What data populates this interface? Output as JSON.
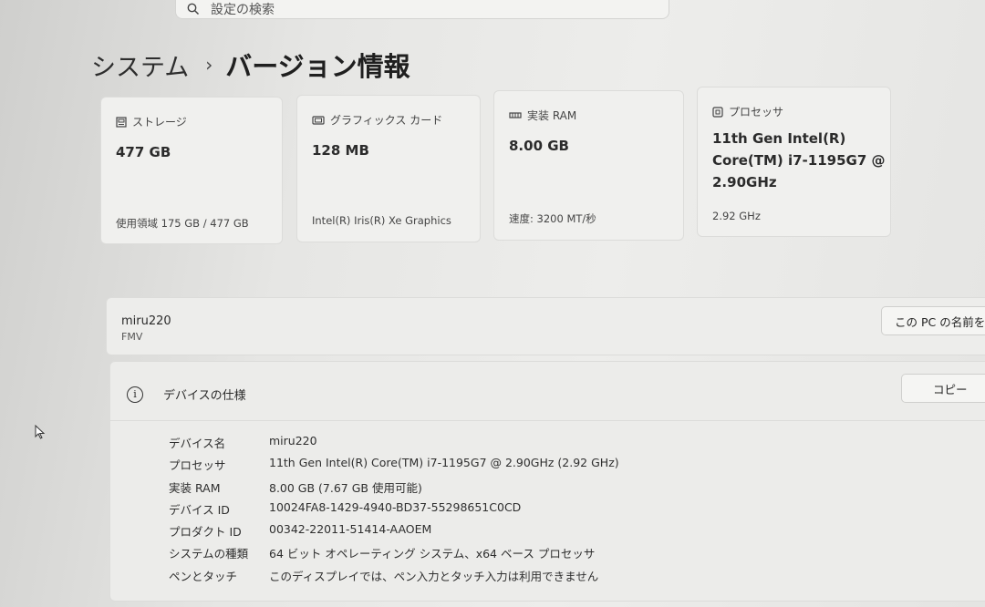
{
  "search": {
    "placeholder": "設定の検索"
  },
  "breadcrumb": {
    "parent": "システム",
    "separator": "›",
    "current": "バージョン情報"
  },
  "cards": [
    {
      "icon": "storage-icon",
      "title": "ストレージ",
      "value": "477 GB",
      "sub": "使用領域 175 GB / 477 GB"
    },
    {
      "icon": "graphics-card-icon",
      "title": "グラフィックス カード",
      "value": "128 MB",
      "sub": "Intel(R) Iris(R) Xe Graphics"
    },
    {
      "icon": "ram-icon",
      "title": "実装 RAM",
      "value": "8.00 GB",
      "sub": "速度: 3200 MT/秒"
    },
    {
      "icon": "processor-icon",
      "title": "プロセッサ",
      "value_lines": [
        "11th Gen Intel(R)",
        "Core(TM) i7-1195G7 @",
        "2.90GHz"
      ],
      "sub": "2.92 GHz"
    }
  ],
  "device": {
    "name": "miru220",
    "model": "FMV",
    "rename_label": "この PC の名前を"
  },
  "spec": {
    "title": "デバイスの仕様",
    "copy_label": "コピー",
    "rows": [
      {
        "key": "デバイス名",
        "value": "miru220"
      },
      {
        "key": "プロセッサ",
        "value": "11th Gen Intel(R) Core(TM) i7-1195G7 @ 2.90GHz (2.92 GHz)"
      },
      {
        "key": "実装 RAM",
        "value": "8.00 GB (7.67 GB 使用可能)"
      },
      {
        "key": "デバイス ID",
        "value": "10024FA8-1429-4940-BD37-55298651C0CD"
      },
      {
        "key": "プロダクト ID",
        "value": "00342-22011-51414-AAOEM"
      },
      {
        "key": "システムの種類",
        "value": "64 ビット オペレーティング システム、x64 ベース プロセッサ"
      },
      {
        "key": "ペンとタッチ",
        "value": "このディスプレイでは、ペン入力とタッチ入力は利用できません"
      }
    ]
  }
}
